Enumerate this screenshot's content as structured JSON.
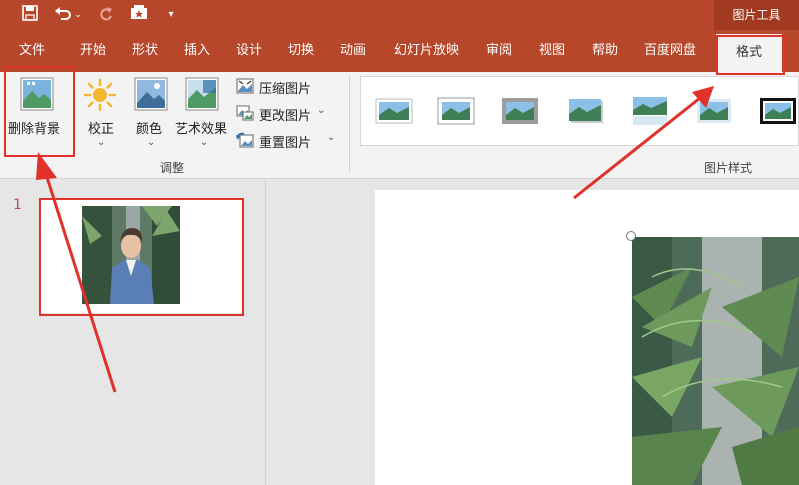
{
  "window": {
    "context_tab_group": "图片工具"
  },
  "tabs": [
    "文件",
    "开始",
    "形状",
    "插入",
    "设计",
    "切换",
    "动画",
    "幻灯片放映",
    "审阅",
    "视图",
    "帮助",
    "百度网盘"
  ],
  "active_tab": "格式",
  "ribbon": {
    "adjust_group": {
      "label": "调整",
      "remove_background": "删除背景",
      "corrections": "校正",
      "color": "颜色",
      "artistic_effects": "艺术效果",
      "compress": "压缩图片",
      "change": "更改图片",
      "reset": "重置图片"
    },
    "styles_group": {
      "label": "图片样式"
    }
  },
  "thumbnail": {
    "number": "1"
  },
  "colors": {
    "accent": "#b7472a",
    "highlight": "#e0322a"
  }
}
